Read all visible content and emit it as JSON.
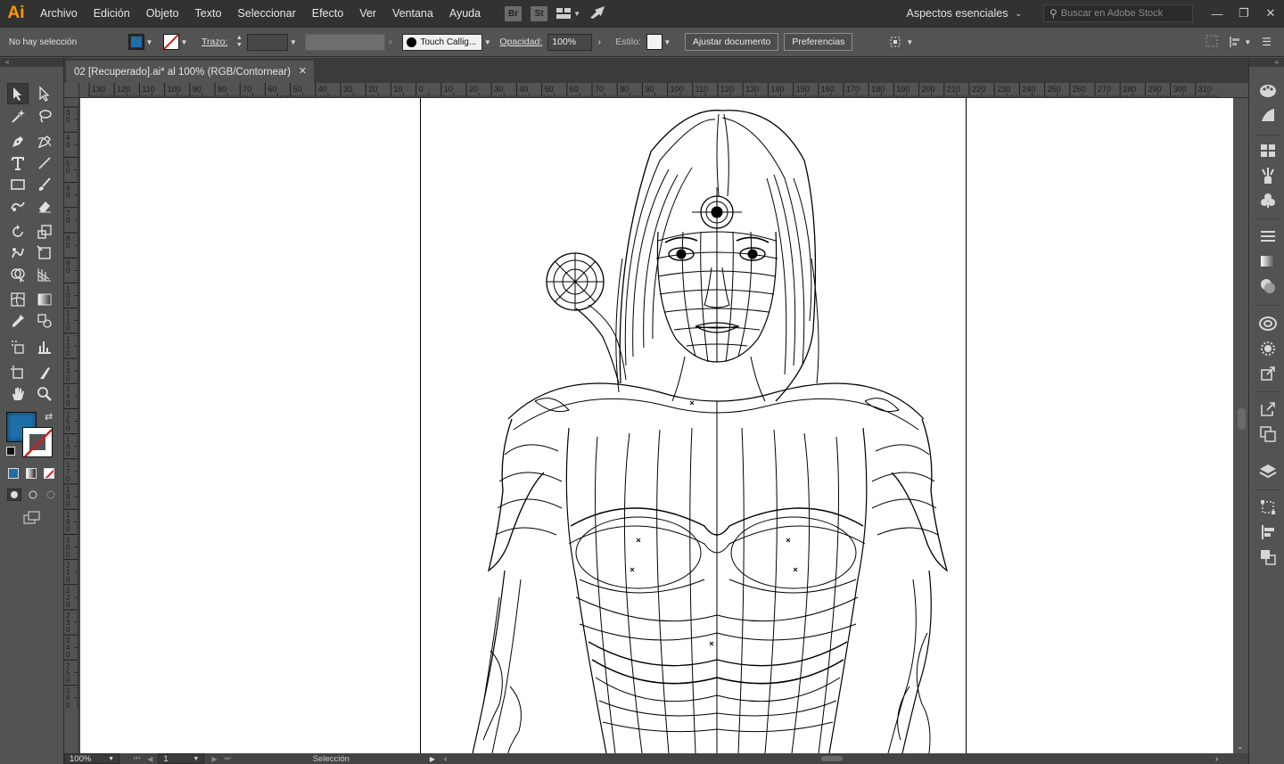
{
  "app": {
    "logo": "Ai",
    "menu": [
      "Archivo",
      "Edición",
      "Objeto",
      "Texto",
      "Seleccionar",
      "Efecto",
      "Ver",
      "Ventana",
      "Ayuda"
    ],
    "bridge_chip": "Br",
    "stock_chip": "St",
    "workspace": "Aspectos esenciales",
    "stock_search_placeholder": "Buscar en Adobe Stock"
  },
  "control": {
    "selection_status": "No hay selección",
    "stroke_label": "Trazo:",
    "brush_name": "Touch Callig...",
    "opacity_label": "Opacidad:",
    "opacity_value": "100%",
    "style_label": "Estilo:",
    "fit_document": "Ajustar documento",
    "preferences": "Preferencias"
  },
  "document": {
    "tab_title": "02 [Recuperado].ai* al 100% (RGB/Contornear)",
    "close_glyph": "✕"
  },
  "rulers": {
    "h_ticks": [
      "130",
      "120",
      "110",
      "100",
      "90",
      "80",
      "70",
      "60",
      "50",
      "40",
      "30",
      "20",
      "10",
      "0",
      "10",
      "20",
      "30",
      "40",
      "50",
      "60",
      "70",
      "80",
      "90",
      "100",
      "110",
      "120",
      "130",
      "140",
      "150",
      "160",
      "170",
      "180",
      "190",
      "200",
      "210",
      "220",
      "230",
      "240",
      "250",
      "260",
      "270",
      "280",
      "290",
      "300",
      "310"
    ],
    "v_ticks": [
      "30",
      "40",
      "50",
      "60",
      "70",
      "80",
      "90",
      "100",
      "110",
      "120",
      "130",
      "140",
      "150",
      "160",
      "170",
      "180",
      "190",
      "200",
      "210",
      "220",
      "230",
      "240",
      "250",
      "260"
    ]
  },
  "status": {
    "zoom": "100%",
    "page": "1",
    "tool_name": "Selección"
  },
  "colors": {
    "fill": "#1e6fa8",
    "accent": "#ff9a00",
    "panel": "#535353",
    "menubar": "#323232"
  },
  "tools_left": [
    "selection-tool",
    "direct-selection-tool",
    "magic-wand-tool",
    "lasso-tool",
    "pen-tool",
    "curvature-tool",
    "type-tool",
    "line-tool",
    "rectangle-tool",
    "paintbrush-tool",
    "shaper-tool",
    "eraser-tool",
    "rotate-tool",
    "scale-tool",
    "warp-tool",
    "free-transform-tool",
    "shape-builder-tool",
    "perspective-grid-tool",
    "mesh-tool",
    "gradient-tool",
    "eyedropper-tool",
    "blend-tool",
    "symbol-sprayer-tool",
    "column-graph-tool",
    "artboard-tool",
    "slice-tool",
    "hand-tool",
    "zoom-tool"
  ],
  "panels_right": [
    "color-icon",
    "color-guide-icon",
    "swatches-icon",
    "brushes-icon",
    "symbols-icon",
    "stroke-icon",
    "gradient-icon",
    "transparency-icon",
    "cc-libraries-icon",
    "appearance-icon",
    "export-icon",
    "asset-export-icon",
    "artboards-icon",
    "layers-icon",
    "transform-icon",
    "align-icon",
    "pathfinder-icon"
  ]
}
